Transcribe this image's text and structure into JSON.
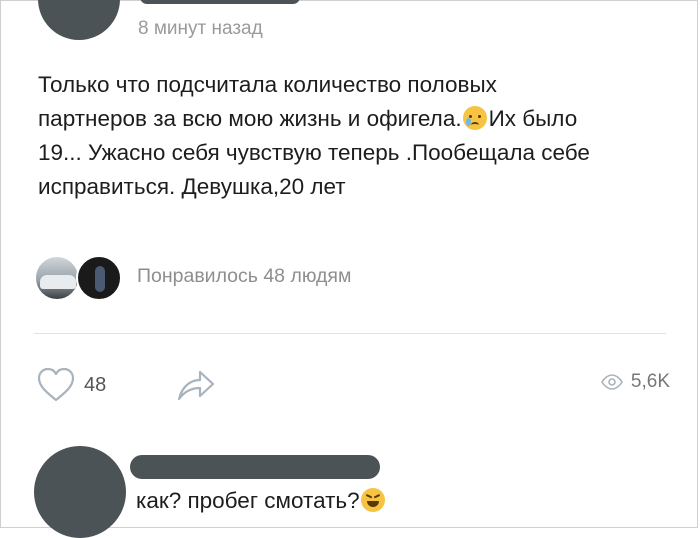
{
  "post": {
    "time": "8 минут назад",
    "text_line1": "Только что подсчитала количество половых",
    "text_line2": "партнеров за всю мою жизнь и офигела.",
    "emoji1": "crying-face",
    "text_line2b": "Их было",
    "text_line3": "19... Ужасно себя чувствую теперь .Пообещала себе",
    "text_line4": "исправиться. Девушка,20 лет",
    "likes_summary": "Понравилось 48 людям"
  },
  "actions": {
    "like_count": "48",
    "views_count": "5,6K",
    "like_icon": "heart-icon",
    "share_icon": "share-icon",
    "views_icon": "eye-icon"
  },
  "comment": {
    "text": "как? пробег смотать?",
    "emoji": "laughing-face"
  },
  "colors": {
    "redaction": "#4b5357",
    "secondary_text": "#8e8e8e",
    "icon": "#a9b3bd"
  }
}
